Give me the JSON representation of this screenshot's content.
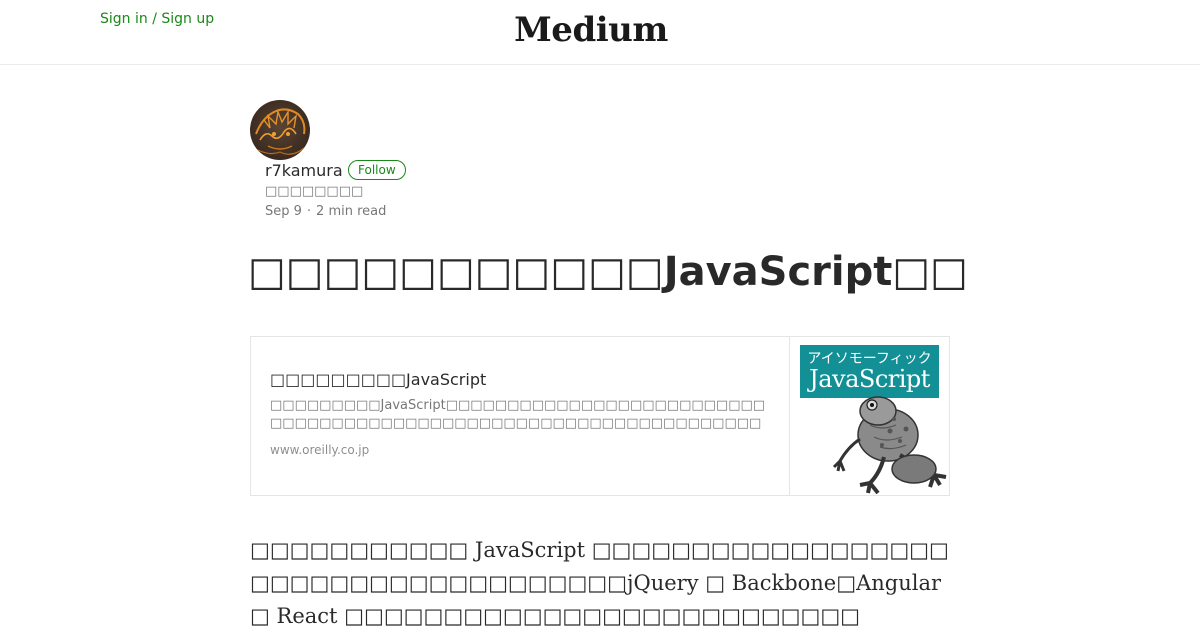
{
  "header": {
    "signin_label": "Sign in / Sign up",
    "brand": "Medium"
  },
  "author": {
    "name": "r7kamura",
    "follow_label": "Follow",
    "bio": "□□□□□□□□",
    "date": "Sep 9",
    "separator": "·",
    "read_time": "2 min read"
  },
  "article": {
    "title": "□□□□□□□□□□□JavaScript□□□□□",
    "embed": {
      "title": "□□□□□□□□□JavaScript",
      "description": "□□□□□□□□□JavaScript□□□□□□□□□□□□□□□□□□□□□□□□□□□□□□□□□□□□□□□□□□□□□□□□□□□□□□□□□□□□□□□□□□□□□□□□□□□□□□□□□□□□SEO□□□□□□□□…",
      "domain": "www.oreilly.co.jp",
      "cover_jp": "アイソモーフィック",
      "cover_en": "JavaScript"
    },
    "body_text": "□□□□□□□□□□□ JavaScript □□□□□□□□□□□□□□□□□□□□□□□□□□□□□□□□□□□□□jQuery □ Backbone□Angular □ React □□□□□□□□□□□□□□□□□□□□□□□□□□"
  },
  "colors": {
    "accent_green": "#1a8917",
    "cover_teal": "#129095"
  },
  "icons": {
    "avatar": "avatar-illustration",
    "cover_art": "frog-illustration"
  }
}
